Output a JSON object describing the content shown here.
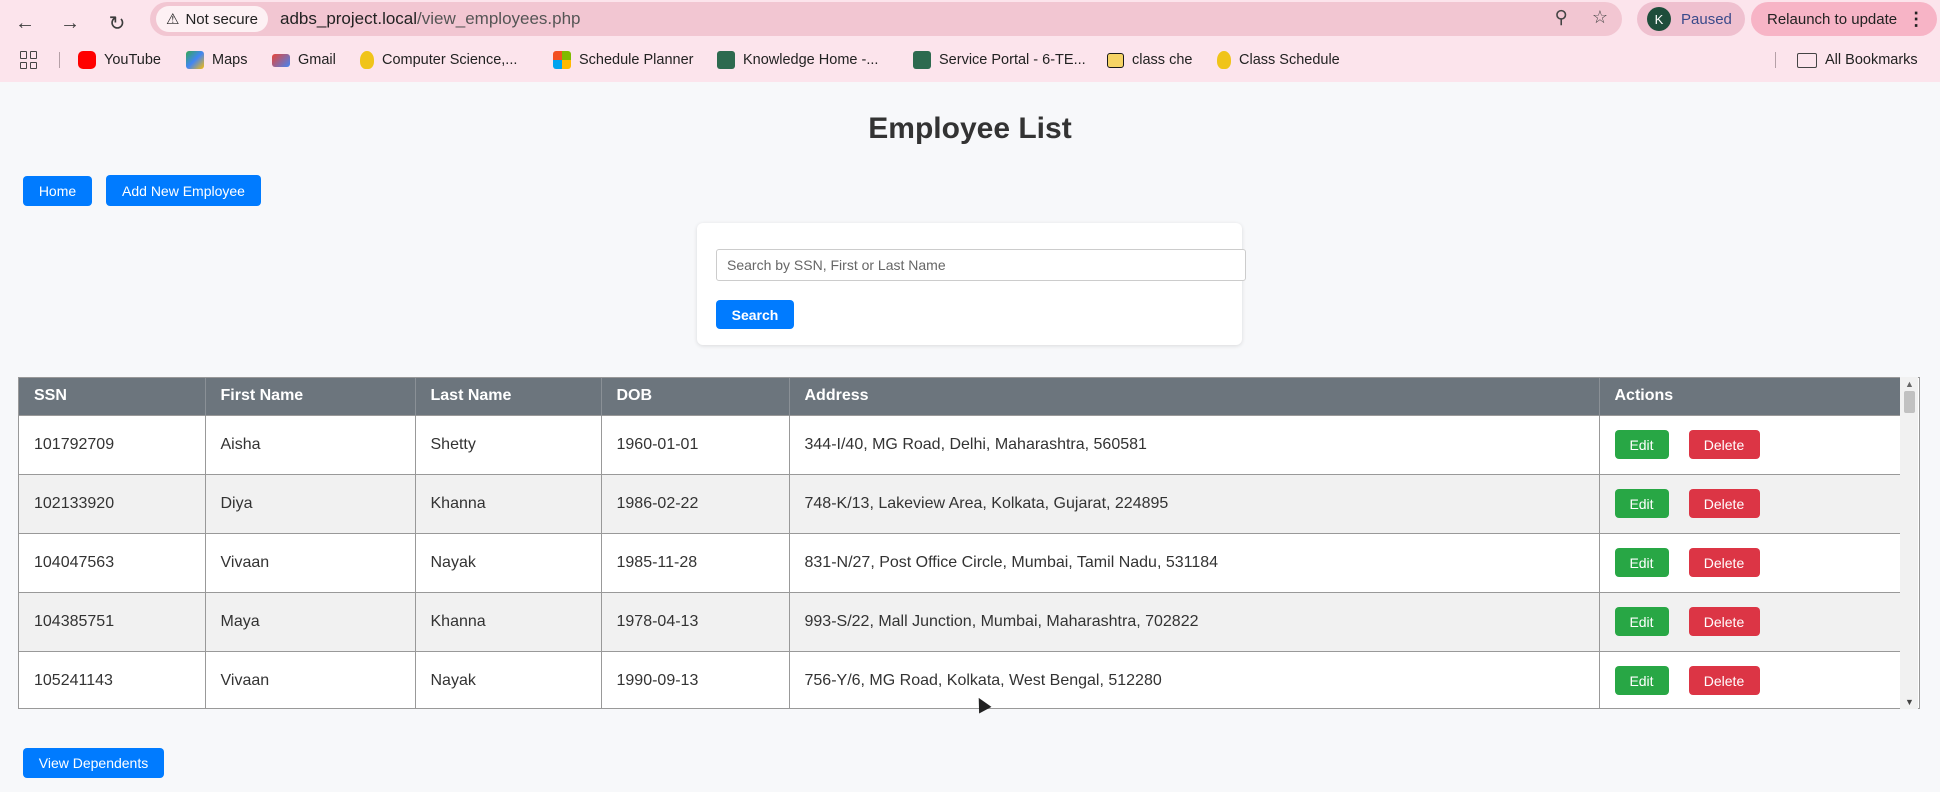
{
  "browser": {
    "not_secure_label": "Not secure",
    "url_host": "adbs_project.local",
    "url_path": "/view_employees.php",
    "profile_initial": "K",
    "profile_status": "Paused",
    "relaunch_label": "Relaunch to update",
    "bookmarks": [
      {
        "label": "YouTube",
        "icon": "youtube-icon",
        "color": "#ff0000"
      },
      {
        "label": "Maps",
        "icon": "maps-icon",
        "color": "#34a853"
      },
      {
        "label": "Gmail",
        "icon": "gmail-icon",
        "color": "#ea4335"
      },
      {
        "label": "Computer Science,...",
        "icon": "university-icon",
        "color": "#d4a017"
      },
      {
        "label": "Schedule Planner",
        "icon": "windows-icon",
        "color": "#0078d4"
      },
      {
        "label": "Knowledge Home -...",
        "icon": "servicenow-icon",
        "color": "#2d6a4f"
      },
      {
        "label": "Service Portal - 6-TE...",
        "icon": "servicenow-icon",
        "color": "#2d6a4f"
      },
      {
        "label": "class che",
        "icon": "class-icon",
        "color": "#1a1a1a"
      },
      {
        "label": "Class Schedule",
        "icon": "university-icon",
        "color": "#d4a017"
      }
    ],
    "all_bookmarks_label": "All Bookmarks"
  },
  "page": {
    "title": "Employee List",
    "home_label": "Home",
    "add_label": "Add New Employee",
    "search_placeholder": "Search by SSN, First or Last Name",
    "search_label": "Search",
    "view_dependents_label": "View Dependents"
  },
  "table": {
    "headers": [
      "SSN",
      "First Name",
      "Last Name",
      "DOB",
      "Address",
      "Actions"
    ],
    "edit_label": "Edit",
    "delete_label": "Delete",
    "rows": [
      [
        "101792709",
        "Aisha",
        "Shetty",
        "1960-01-01",
        "344-I/40, MG Road, Delhi, Maharashtra, 560581"
      ],
      [
        "102133920",
        "Diya",
        "Khanna",
        "1986-02-22",
        "748-K/13, Lakeview Area, Kolkata, Gujarat, 224895"
      ],
      [
        "104047563",
        "Vivaan",
        "Nayak",
        "1985-11-28",
        "831-N/27, Post Office Circle, Mumbai, Tamil Nadu, 531184"
      ],
      [
        "104385751",
        "Maya",
        "Khanna",
        "1978-04-13",
        "993-S/22, Mall Junction, Mumbai, Maharashtra, 702822"
      ],
      [
        "105241143",
        "Vivaan",
        "Nayak",
        "1990-09-13",
        "756-Y/6, MG Road, Kolkata, West Bengal, 512280"
      ]
    ]
  }
}
